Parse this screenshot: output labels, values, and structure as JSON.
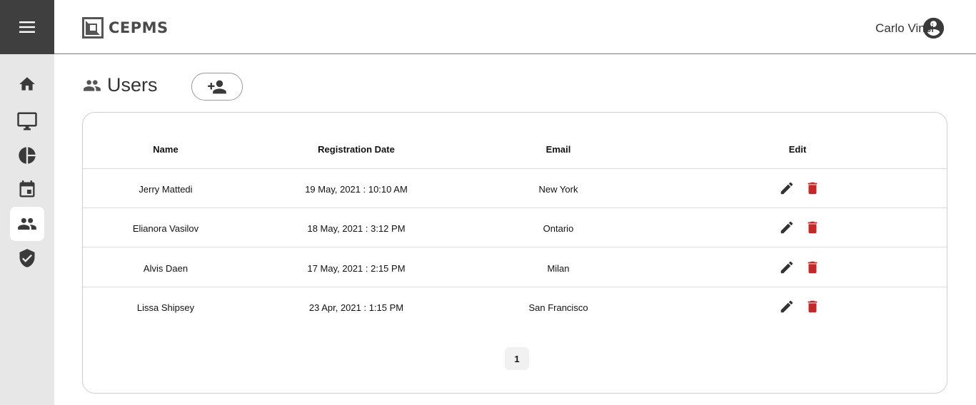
{
  "app": {
    "logo_text": "CEPMS"
  },
  "header": {
    "user_name": "Carlo Vinci"
  },
  "sidebar": {
    "items": [
      {
        "icon": "home-icon"
      },
      {
        "icon": "monitor-icon"
      },
      {
        "icon": "pie-chart-icon"
      },
      {
        "icon": "calendar-icon"
      },
      {
        "icon": "users-icon",
        "active": true
      },
      {
        "icon": "shield-check-icon"
      }
    ]
  },
  "page": {
    "title": "Users"
  },
  "table": {
    "columns": [
      "Name",
      "Registration Date",
      "Email",
      "Edit"
    ],
    "rows": [
      {
        "name": "Jerry Mattedi",
        "date": "19 May, 2021 : 10:10 AM",
        "email": "New York"
      },
      {
        "name": "Elianora Vasilov",
        "date": "18 May, 2021 : 3:12 PM",
        "email": "Ontario"
      },
      {
        "name": "Alvis Daen",
        "date": "17 May, 2021 : 2:15 PM",
        "email": "Milan"
      },
      {
        "name": "Lissa Shipsey",
        "date": "23 Apr, 2021 : 1:15 PM",
        "email": "San Francisco"
      }
    ]
  },
  "pagination": {
    "current": "1"
  },
  "colors": {
    "sidebar_dark": "#3f3f3f",
    "sidebar_bg": "#e7e7e7",
    "icon": "#3a3a3a",
    "delete": "#c62828"
  }
}
